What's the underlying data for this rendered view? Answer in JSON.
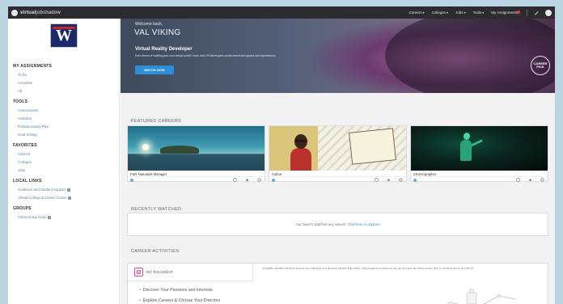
{
  "topnav": {
    "logo_text_bold": "virtual",
    "logo_text": "jobshadow",
    "items": [
      {
        "label": "Careers",
        "caret": "▾"
      },
      {
        "label": "Colleges",
        "caret": "▾"
      },
      {
        "label": "Jobs",
        "caret": "▾"
      },
      {
        "label": "Tools",
        "caret": "▾"
      },
      {
        "label": "My Assignments",
        "caret": ""
      }
    ]
  },
  "sidebar": {
    "sections": [
      {
        "heading": "MY ASSIGNMENTS",
        "links": [
          "To Do",
          "Complete",
          "All"
        ]
      },
      {
        "heading": "TOOLS",
        "links": [
          "Assessments",
          "Activities",
          "Postsecondary Plan",
          "Goal Setting"
        ]
      },
      {
        "heading": "FAVORITES",
        "links": [
          "Careers",
          "Colleges",
          "Jobs"
        ]
      },
      {
        "heading": "LOCAL LINKS",
        "links": [
          "Guidance and Student Support",
          "Virtual College & Career Center"
        ]
      },
      {
        "heading": "GROUPS",
        "links": [
          "Class Group Code"
        ]
      }
    ]
  },
  "hero": {
    "welcome": "Welcome back,",
    "name": "VAL VIKING",
    "career_title": "Virtual Reality Developer",
    "description": "Ever dream of building your own virtual world? Learn how VR developers create immersive games and experiences.",
    "button_label": "WATCH NOW",
    "badge_text": "CAREER PICK"
  },
  "featured": {
    "title": "FEATURED CAREERS",
    "cards": [
      {
        "name": "Park Naturalist Manager"
      },
      {
        "name": "Author"
      },
      {
        "name": "Choreographer"
      }
    ]
  },
  "recent": {
    "title": "RECENTLY WATCHED",
    "empty_text": "You haven't watched any videos!",
    "link_text": "Click here to explore!"
  },
  "activities": {
    "title": "CAREER ACTIVITIES",
    "tab_label": "MY ROADMAP",
    "description": "Complete activities below to explore your interests and discover careers that match. Your progress is saved as you go, and you can return at any time to continue where you left off.",
    "items": [
      "Discover Your Passions and Interests",
      "Explore Careers & Choose Your Direction"
    ]
  },
  "colors": {
    "nav_bg": "#2b2b30",
    "accent_blue": "#2d8fd6",
    "accent_pink": "#d9488c",
    "link": "#5a84a8"
  }
}
